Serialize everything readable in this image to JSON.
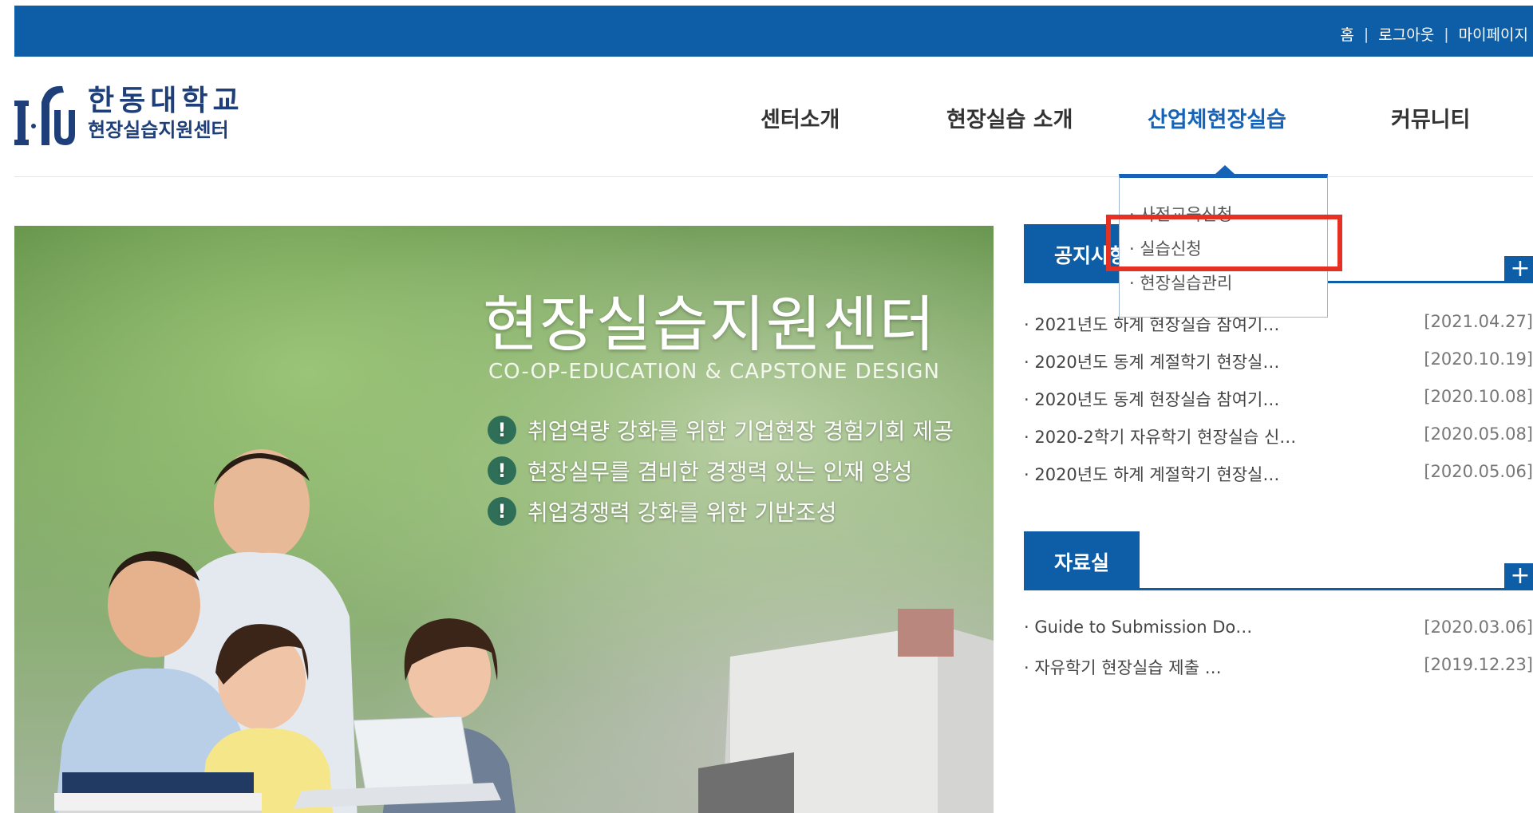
{
  "util_links": [
    "홈",
    "로그아웃",
    "마이페이지"
  ],
  "logo": {
    "mark": "HGU",
    "line1": "한동대학교",
    "line2": "현장실습지원센터"
  },
  "nav": [
    {
      "label": "센터소개",
      "active": false
    },
    {
      "label": "현장실습 소개",
      "active": false
    },
    {
      "label": "산업체현장실습",
      "active": true
    },
    {
      "label": "커뮤니티",
      "active": false
    }
  ],
  "dropdown": [
    "· 사전교육신청",
    "· 실습신청",
    "· 현장실습관리"
  ],
  "banner": {
    "title": "현장실습지원센터",
    "subtitle": "CO-OP-EDUCATION & CAPSTONE DESIGN",
    "bullets": [
      "취업역량 강화를 위한 기업현장 경험기회 제공",
      "현장실무를 겸비한 경쟁력 있는 인재 양성",
      "취업경쟁력 강화를 위한 기반조성"
    ]
  },
  "notice": {
    "title": "공지사항",
    "plus": "+",
    "items": [
      {
        "title": "· 2021년도 하계 현장실습 참여기…",
        "date": "[2021.04.27]"
      },
      {
        "title": "· 2020년도 동계 계절학기 현장실…",
        "date": "[2020.10.19]"
      },
      {
        "title": "· 2020년도 동계 현장실습 참여기…",
        "date": "[2020.10.08]"
      },
      {
        "title": "· 2020-2학기 자유학기 현장실습 신…",
        "date": "[2020.05.08]"
      },
      {
        "title": "· 2020년도 하계 계절학기 현장실…",
        "date": "[2020.05.06]"
      }
    ]
  },
  "archive": {
    "title": "자료실",
    "plus": "+",
    "items": [
      {
        "title": "· Guide to Submission Do…",
        "date": "[2020.03.06]"
      },
      {
        "title": "· 자유학기 현장실습 제출 …",
        "date": "[2019.12.23]"
      }
    ]
  },
  "colors": {
    "primary": "#0d5ea6",
    "active_nav": "#1562b6",
    "highlight": "#e53124"
  }
}
